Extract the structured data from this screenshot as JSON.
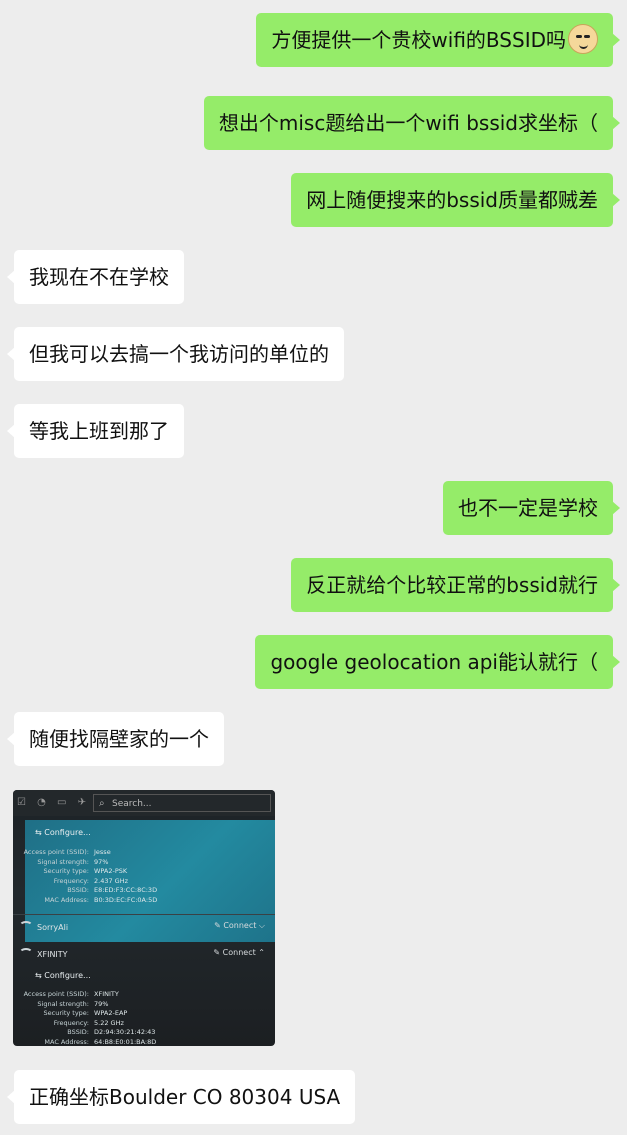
{
  "messages": [
    {
      "side": "me",
      "text": "方便提供一个贵校wifi的BSSID吗"
    },
    {
      "side": "me",
      "text": "想出个misc题给出一个wifi bssid求坐标（"
    },
    {
      "side": "me",
      "text": "网上随便搜来的bssid质量都贼差"
    },
    {
      "side": "other",
      "text": "我现在不在学校"
    },
    {
      "side": "other",
      "text": "但我可以去搞一个我访问的单位的"
    },
    {
      "side": "other",
      "text": "等我上班到那了"
    },
    {
      "side": "me",
      "text": "也不一定是学校"
    },
    {
      "side": "me",
      "text": "反正就给个比较正常的bssid就行"
    },
    {
      "side": "me",
      "text": "google geolocation api能认就行（"
    },
    {
      "side": "other",
      "text": "随便找隔壁家的一个"
    },
    {
      "side": "other",
      "text": "正确坐标Boulder CO 80304 USA"
    }
  ],
  "emoji": "doge-emoji",
  "screenshot": {
    "search_placeholder": "Search...",
    "configure_label": "Configure...",
    "top_details": {
      "ssid_label": "Access point (SSID):",
      "ssid_value": "Jesse",
      "strength_label": "Signal strength:",
      "strength_value": "97%",
      "security_label": "Security type:",
      "security_value": "WPA2-PSK",
      "freq_label": "Frequency:",
      "freq_value": "2.437 GHz",
      "bssid_label": "BSSID:",
      "bssid_value": "E8:ED:F3:CC:8C:3D",
      "mac_label": "MAC Address:",
      "mac_value": "B0:3D:EC:FC:0A:5D"
    },
    "networks": [
      {
        "name": "SorryAli",
        "action": "Connect"
      },
      {
        "name": "XFINITY",
        "action": "Connect"
      }
    ],
    "bottom_details": {
      "ssid_label": "Access point (SSID):",
      "ssid_value": "XFINITY",
      "strength_label": "Signal strength:",
      "strength_value": "79%",
      "security_label": "Security type:",
      "security_value": "WPA2-EAP",
      "freq_label": "Frequency:",
      "freq_value": "5.22 GHz",
      "bssid_label": "BSSID:",
      "bssid_value": "D2:94:30:21:42:43",
      "mac_label": "MAC Address:",
      "mac_value": "64:B8:E0:01:BA:8D"
    }
  }
}
